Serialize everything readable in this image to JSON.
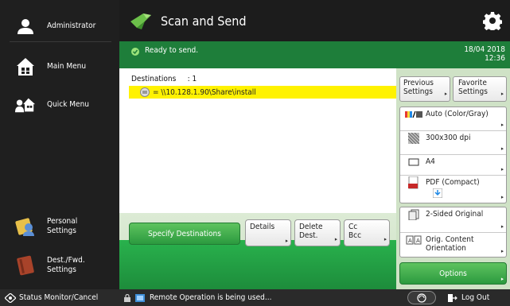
{
  "sidebar": {
    "user_label": "Administrator",
    "items": [
      {
        "label": "Main Menu"
      },
      {
        "label": "Quick Menu"
      },
      {
        "label": "Personal\nSettings"
      },
      {
        "label": "Dest./Fwd.\nSettings"
      }
    ]
  },
  "header": {
    "title": "Scan and Send",
    "icon": "scan-send-icon"
  },
  "status": {
    "text": "Ready to send.",
    "date": "18/04 2018",
    "time": "12:36",
    "color": "#1e7e3a"
  },
  "destinations": {
    "header": "Destinations     : 1",
    "items": [
      {
        "address": "= \\\\10.128.1.90\\Share\\install"
      }
    ],
    "highlight_color": "#fff200"
  },
  "actions": {
    "specify": "Specify Destinations",
    "details": "Details",
    "delete_line1": "Delete",
    "delete_line2": "Dest.",
    "cc_line1": "Cc",
    "cc_line2": "Bcc"
  },
  "settings": {
    "previous_line1": "Previous",
    "previous_line2": "Settings",
    "favorite_line1": "Favorite",
    "favorite_line2": "Settings",
    "color_mode": "Auto (Color/Gray)",
    "resolution": "300x300 dpi",
    "paper": "A4",
    "file_format": "PDF (Compact)",
    "sided": "2-Sided Original",
    "orientation": "Orig. Content\nOrientation",
    "options": "Options"
  },
  "bottom": {
    "status_monitor": "Status Monitor/Cancel",
    "remote_message": "Remote Operation is being used...",
    "logout": "Log Out"
  },
  "colors": {
    "accent_green": "#2b9a3f",
    "panel_green": "#cfe2c6",
    "dark_bg": "#1f1f1f"
  }
}
